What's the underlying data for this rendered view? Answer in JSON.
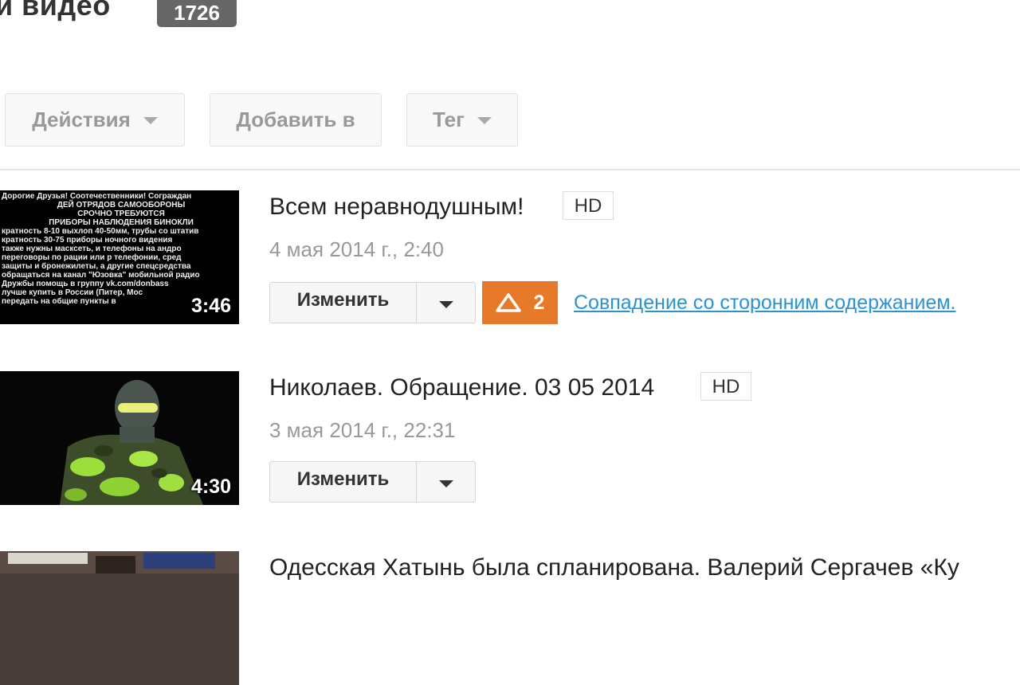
{
  "header": {
    "title": "и видео",
    "count": "1726"
  },
  "toolbar": {
    "actions_label": "Действия",
    "add_to_label": "Добавить в",
    "tag_label": "Тег"
  },
  "videos": [
    {
      "title": "Всем неравнодушным!",
      "hd": "HD",
      "date": "4 мая 2014 г., 2:40",
      "duration": "3:46",
      "edit_label": "Изменить",
      "warning_count": "2",
      "match_text": "Совпадение со сторонним содержанием.",
      "thumb_text": [
        "Дорогие Друзья! Соотечественники! Сограждан",
        "ДЕЙ ОТРЯДОВ САМООБОРОНЫ",
        "СРОЧНО ТРЕБУЮТСЯ",
        "ПРИБОРЫ НАБЛЮДЕНИЯ БИНОКЛИ",
        "кратность 8-10 выхлоп 40-50мм, трубы со штатив",
        "кратность 30-75 приборы ночного видения",
        "также нужны масксеть, и телефоны на андро",
        "переговоры по рации или р телефонии, сред",
        "защиты и бронежилеты, а другие спецсредства",
        "обращаться на канал \"Юзовка\" мобильной радио",
        "Дружбы помощь в группу vk.com/donbass",
        "лучше купить в России (Питер, Мос",
        "передать на общие пункты в"
      ]
    },
    {
      "title": "Николаев. Обращение. 03 05 2014",
      "hd": "HD",
      "date": "3 мая 2014 г., 22:31",
      "duration": "4:30",
      "edit_label": "Изменить"
    },
    {
      "title": "Одесская Хатынь была спланирована. Валерий Сергачев «Ку"
    }
  ]
}
